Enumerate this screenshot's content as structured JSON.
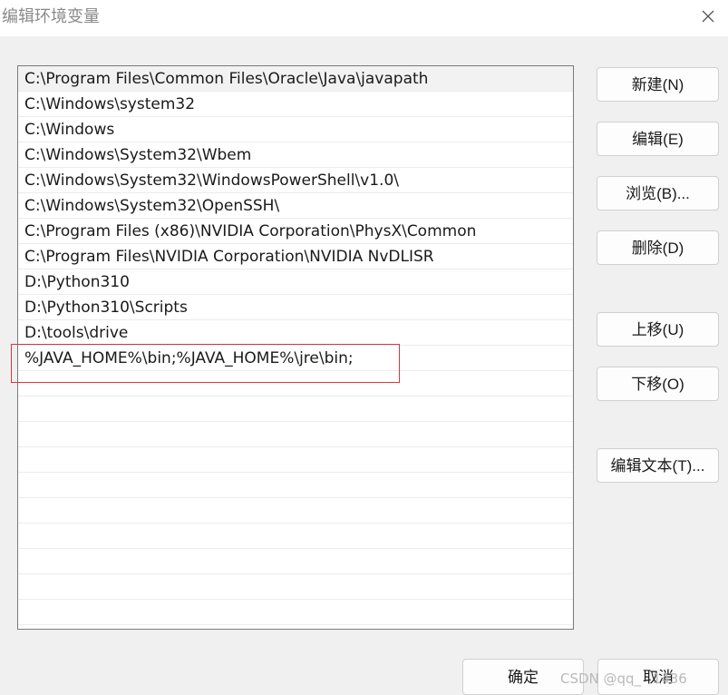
{
  "window": {
    "title": "编辑环境变量",
    "close_icon": "close-icon"
  },
  "path_list": {
    "items": [
      "C:\\Program Files\\Common Files\\Oracle\\Java\\javapath",
      "C:\\Windows\\system32",
      "C:\\Windows",
      "C:\\Windows\\System32\\Wbem",
      "C:\\Windows\\System32\\WindowsPowerShell\\v1.0\\",
      "C:\\Windows\\System32\\OpenSSH\\",
      "C:\\Program Files (x86)\\NVIDIA Corporation\\PhysX\\Common",
      "C:\\Program Files\\NVIDIA Corporation\\NVIDIA NvDLISR",
      "D:\\Python310",
      "D:\\Python310\\Scripts",
      "D:\\tools\\drive",
      "%JAVA_HOME%\\bin;%JAVA_HOME%\\jre\\bin;"
    ],
    "selected_index": 0,
    "highlight_color": "#d9363e"
  },
  "buttons": {
    "new": "新建(N)",
    "edit": "编辑(E)",
    "browse": "浏览(B)...",
    "delete": "删除(D)",
    "move_up": "上移(U)",
    "move_down": "下移(O)",
    "edit_text": "编辑文本(T)...",
    "ok": "确定",
    "cancel": "取消"
  },
  "watermark": "CSDN @qq_    1436"
}
